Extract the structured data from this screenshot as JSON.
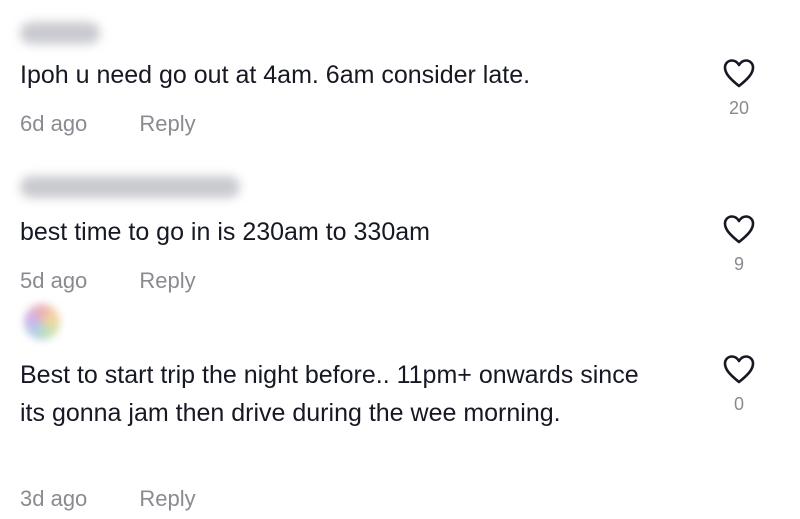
{
  "comments": [
    {
      "text": "Ipoh u need go out at 4am. 6am consider late.",
      "age": "6d ago",
      "reply_label": "Reply",
      "likes": "20"
    },
    {
      "text": "best time to go in is 230am to 330am",
      "age": "5d ago",
      "reply_label": "Reply",
      "likes": "9"
    },
    {
      "text": "Best to start trip the night before.. 11pm+ onwards since its gonna jam then drive during the wee morning.",
      "age": "3d ago",
      "reply_label": "Reply",
      "likes": "0"
    }
  ],
  "icons": {
    "like": "heart-outline-icon"
  },
  "colors": {
    "text": "#161823",
    "meta": "#8a8b91",
    "background": "#ffffff"
  }
}
